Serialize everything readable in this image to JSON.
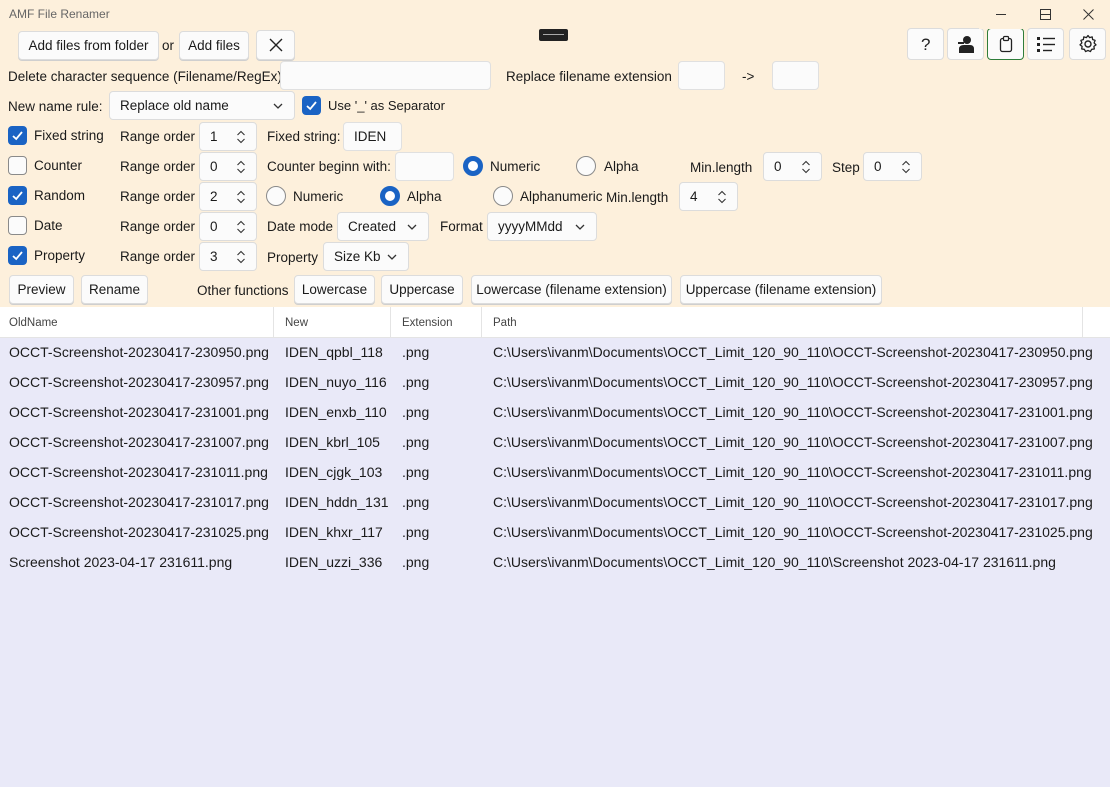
{
  "window": {
    "title": "AMF File Renamer"
  },
  "toolbar": {
    "add_from_folder": "Add files from folder",
    "or": "or",
    "add_files": "Add files"
  },
  "delete_seq": {
    "label": "Delete character sequence (Filename/RegEx)",
    "value": ""
  },
  "replace_ext": {
    "label": "Replace filename extension",
    "from": "",
    "arrow": "->",
    "to": ""
  },
  "new_name_rule": {
    "label": "New name rule:",
    "value": "Replace old name",
    "separator_label": "Use '_' as Separator"
  },
  "range_label": "Range order",
  "fixed": {
    "label": "Fixed string",
    "order": "1",
    "field_label": "Fixed string:",
    "value": "IDEN"
  },
  "counter": {
    "label": "Counter",
    "order": "0",
    "begin_label": "Counter beginn with:",
    "begin_value": "",
    "numeric": "Numeric",
    "alpha": "Alpha",
    "minlen_label": "Min.length",
    "minlen": "0",
    "step_label": "Step",
    "step": "0"
  },
  "random": {
    "label": "Random",
    "order": "2",
    "numeric": "Numeric",
    "alpha": "Alpha",
    "alphanumeric": "Alphanumeric",
    "minlen_label": "Min.length",
    "minlen": "4"
  },
  "date": {
    "label": "Date",
    "order": "0",
    "mode_label": "Date mode",
    "mode": "Created",
    "format_label": "Format",
    "format": "yyyyMMdd"
  },
  "property": {
    "label": "Property",
    "order": "3",
    "field_label": "Property",
    "value": "Size Kb"
  },
  "actions": {
    "preview": "Preview",
    "rename": "Rename",
    "other": "Other functions",
    "lowercase": "Lowercase",
    "uppercase": "Uppercase",
    "lower_ext": "Lowercase (filename extension)",
    "upper_ext": "Uppercase (filename extension)"
  },
  "table": {
    "columns": [
      "OldName",
      "New",
      "Extension",
      "Path"
    ],
    "rows": [
      [
        "OCCT-Screenshot-20230417-230950.png",
        "IDEN_qpbl_118",
        ".png",
        "C:\\Users\\ivanm\\Documents\\OCCT_Limit_120_90_110\\OCCT-Screenshot-20230417-230950.png"
      ],
      [
        "OCCT-Screenshot-20230417-230957.png",
        "IDEN_nuyo_116",
        ".png",
        "C:\\Users\\ivanm\\Documents\\OCCT_Limit_120_90_110\\OCCT-Screenshot-20230417-230957.png"
      ],
      [
        "OCCT-Screenshot-20230417-231001.png",
        "IDEN_enxb_110",
        ".png",
        "C:\\Users\\ivanm\\Documents\\OCCT_Limit_120_90_110\\OCCT-Screenshot-20230417-231001.png"
      ],
      [
        "OCCT-Screenshot-20230417-231007.png",
        "IDEN_kbrl_105",
        ".png",
        "C:\\Users\\ivanm\\Documents\\OCCT_Limit_120_90_110\\OCCT-Screenshot-20230417-231007.png"
      ],
      [
        "OCCT-Screenshot-20230417-231011.png",
        "IDEN_cjgk_103",
        ".png",
        "C:\\Users\\ivanm\\Documents\\OCCT_Limit_120_90_110\\OCCT-Screenshot-20230417-231011.png"
      ],
      [
        "OCCT-Screenshot-20230417-231017.png",
        "IDEN_hddn_131",
        ".png",
        "C:\\Users\\ivanm\\Documents\\OCCT_Limit_120_90_110\\OCCT-Screenshot-20230417-231017.png"
      ],
      [
        "OCCT-Screenshot-20230417-231025.png",
        "IDEN_khxr_117",
        ".png",
        "C:\\Users\\ivanm\\Documents\\OCCT_Limit_120_90_110\\OCCT-Screenshot-20230417-231025.png"
      ],
      [
        "Screenshot 2023-04-17 231611.png",
        "IDEN_uzzi_336",
        ".png",
        "C:\\Users\\ivanm\\Documents\\OCCT_Limit_120_90_110\\Screenshot 2023-04-17 231611.png"
      ]
    ]
  },
  "colors": {
    "panel": "#fdf0dc",
    "accent": "#1a63c4",
    "list_bg": "#e9e9f8"
  },
  "icons": [
    "question-icon",
    "user-icon",
    "clipboard-icon",
    "list-icon",
    "gear-icon",
    "close-icon",
    "drag-handle-icon"
  ]
}
